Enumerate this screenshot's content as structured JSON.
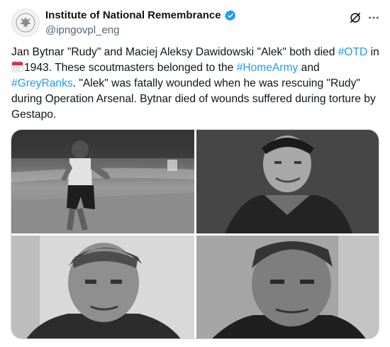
{
  "account": {
    "display_name": "Institute of National Remembrance",
    "handle": "@ipngovpl_eng",
    "verified_color": "#1d9bf0"
  },
  "icons": {
    "avatar": "eagle-emblem-icon",
    "verified": "verified-badge-icon",
    "grok": "grok-icon",
    "more": "more-options-icon",
    "calendar": "calendar-emoji"
  },
  "tweet": {
    "t1": "Jan Bytnar \"Rudy\" and Maciej Aleksy Dawidowski \"Alek\" both died ",
    "tag_otd": "#OTD",
    "t2": " in ",
    "t3": "1943. These scoutmasters belonged to the ",
    "tag_homearmy": "#HomeArmy",
    "t4": " and ",
    "tag_greyranks": "#GreyRanks",
    "t5": ". \"Alek\" was fatally wounded when he was rescuing \"Rudy\" during Operation Arsenal. Bytnar died of wounds suffered during torture by Gestapo."
  },
  "media": {
    "photos": [
      "photo-running-athlete",
      "photo-scout-uniform-portrait",
      "photo-young-man-portrait",
      "photo-man-portrait"
    ]
  },
  "colors": {
    "hashtag": "#1d9bf0",
    "text": "#0f1419",
    "secondary": "#536471",
    "border": "#cfd9de"
  }
}
